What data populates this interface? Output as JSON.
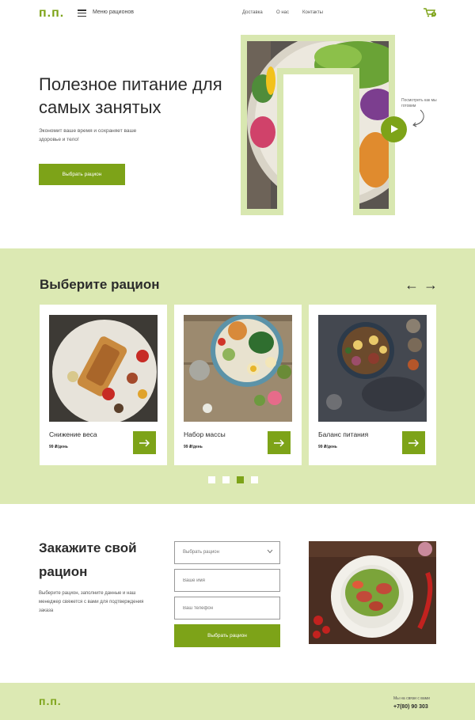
{
  "header": {
    "logo": "п.п.",
    "menu_label": "Меню рационов",
    "nav": [
      "Доставка",
      "О нас",
      "Контакты"
    ],
    "cart_count": "0"
  },
  "hero": {
    "title": "Полезное питание для самых занятых",
    "subtitle": "Экономит ваше время и сохраняет ваше здоровье и тело!",
    "button": "Выбрать рацион",
    "video_note": "Посмотреть как мы готовим"
  },
  "diets": {
    "title": "Выберите рацион",
    "prev": "←",
    "next": "→",
    "cards": [
      {
        "title": "Снижение веса",
        "price": "99 ₽/день"
      },
      {
        "title": "Набор массы",
        "price": "99 ₽/день"
      },
      {
        "title": "Баланс питания",
        "price": "99 ₽/день"
      }
    ],
    "active_dot": 3
  },
  "order": {
    "title": "Закажите свой рацион",
    "text": "Выберите рацион, заполните данные и наш менеджер свяжется с вами для подтверждения заказа",
    "select_placeholder": "Выбрать рацион",
    "name_placeholder": "Ваше имя",
    "phone_placeholder": "Ваш телефон",
    "button": "Выбрать рацион"
  },
  "footer": {
    "logo": "п.п.",
    "note": "Мы на связи с вами",
    "phone": "+7(80) 90 303"
  },
  "colors": {
    "accent": "#7da318",
    "light_green": "#dce9b3"
  }
}
